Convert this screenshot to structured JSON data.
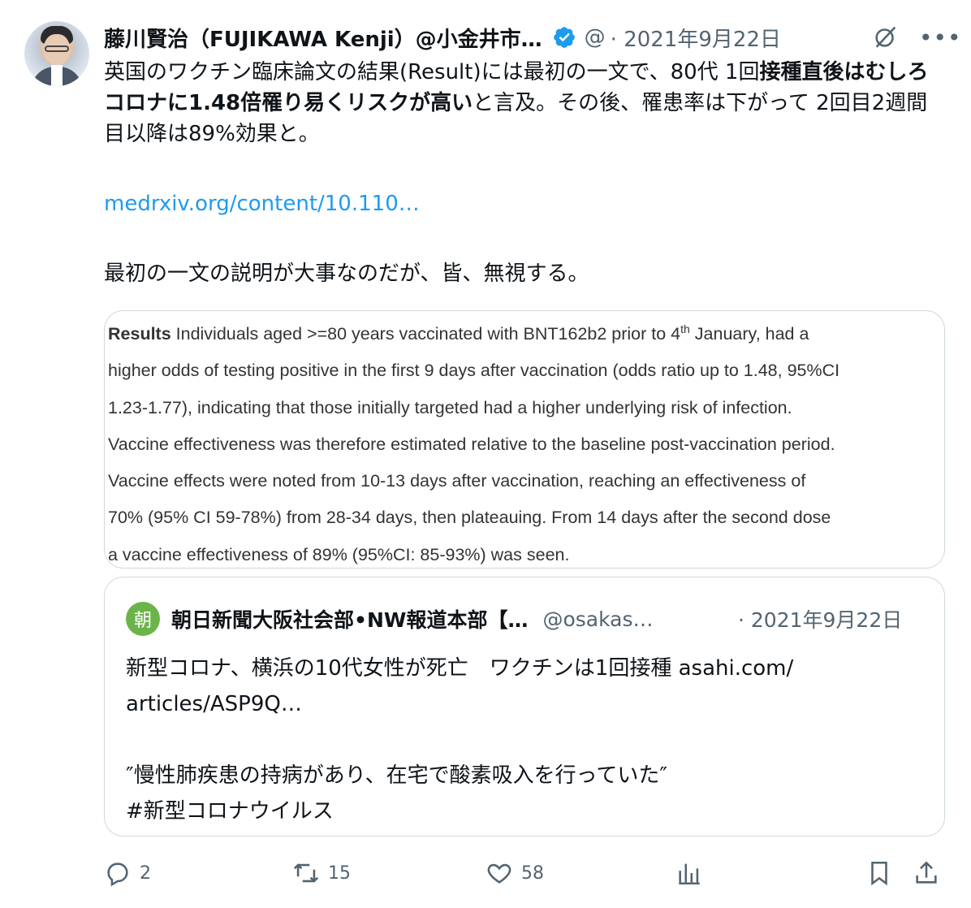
{
  "tweet": {
    "author_name": "藤川賢治（FUJIKAWA Kenji）@小金井市…",
    "handle": "@",
    "date": "· 2021年9月22日",
    "text_plain_1": "英国のワクチン臨床論文の結果(Result)には最初の一文で、80代 1回",
    "text_bold_1": "接種直後はむしろコロナに1.48倍罹り易くリスクが高い",
    "text_plain_2": "と言及。その後、罹患率は下がって 2回目2週間目以降は89%効果と。",
    "link": "medrxiv.org/content/10.110…",
    "text_2": "最初の一文の説明が大事なのだが、皆、無視する。"
  },
  "media": {
    "results_label": "Results",
    "line1_pre": " Individuals aged >=80 years vaccinated with BNT162b2 prior to 4",
    "line1_sup": "th",
    "line1_post": " January, had a",
    "line2": "higher odds of testing positive in the first 9 days after vaccination (odds ratio up to 1.48, 95%CI",
    "line3": "1.23-1.77), indicating that those initially targeted had a higher underlying risk of infection.",
    "line4": "Vaccine effectiveness was therefore estimated relative to the baseline post-vaccination period.",
    "line5": "Vaccine effects were noted from 10-13 days after vaccination, reaching an effectiveness of",
    "line6": "70% (95% CI 59-78%) from 28-34 days, then plateauing. From 14 days after the second dose",
    "line7": "a vaccine effectiveness of 89% (95%CI: 85-93%) was seen."
  },
  "quote": {
    "avatar_char": "朝",
    "name": "朝日新聞大阪社会部•NW報道本部【…",
    "handle": "@osakas…",
    "date": "· 2021年9月22日",
    "line1": "新型コロナ、横浜の10代女性が死亡　ワクチンは1回接種 asahi.com/",
    "line2": "articles/ASP9Q…",
    "line3": "″慢性肺疾患の持病があり、在宅で酸素吸入を行っていた″",
    "line4": "#新型コロナウイルス"
  },
  "actions": {
    "replies": "2",
    "retweets": "15",
    "likes": "58"
  },
  "colors": {
    "link": "#1d9bf0",
    "secondary": "#536471",
    "verified": "#1d9bf0",
    "quote_avatar": "#6bb44a"
  },
  "icons": [
    "verified-badge-icon",
    "grok-icon",
    "more-icon",
    "reply-icon",
    "retweet-icon",
    "like-icon",
    "views-icon",
    "bookmark-icon",
    "share-icon"
  ]
}
